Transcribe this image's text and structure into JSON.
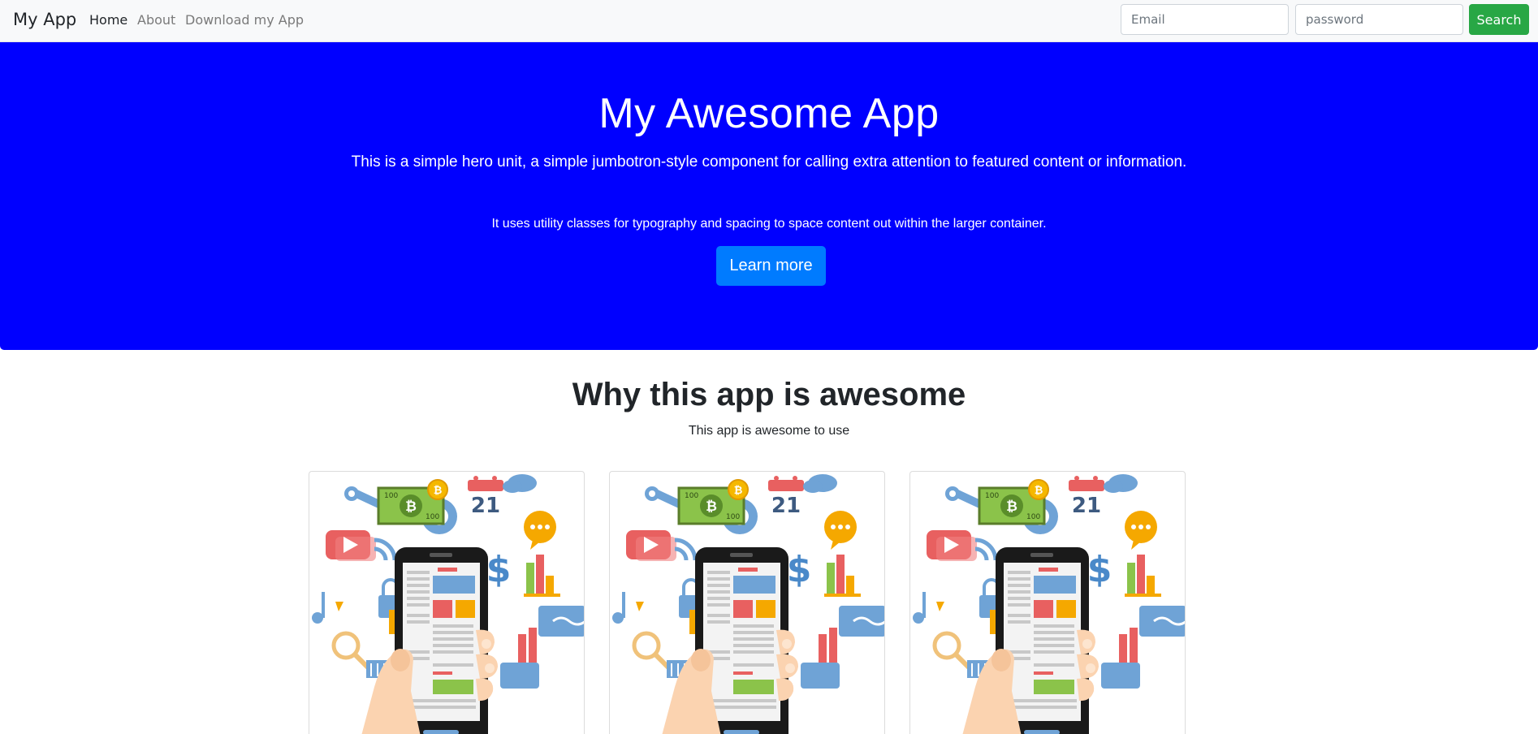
{
  "navbar": {
    "brand": "My App",
    "links": [
      "Home",
      "About",
      "Download my App"
    ],
    "email_placeholder": "Email",
    "password_placeholder": "password",
    "search_label": "Search"
  },
  "hero": {
    "title": "My Awesome App",
    "lead": "This is a simple hero unit, a simple jumbotron-style component for calling extra attention to featured content or information.",
    "text": "It uses utility classes for typography and spacing to space content out within the larger container.",
    "button_label": "Learn more",
    "background": "#0000ff",
    "button_color": "#007bff"
  },
  "features": {
    "title": "Why this app is awesome",
    "subtitle": "This app is awesome to use",
    "cards": [
      {
        "image": "mobile-app-illustration",
        "calendar_day": "21",
        "bill_value": "100"
      },
      {
        "image": "mobile-app-illustration",
        "calendar_day": "21",
        "bill_value": "100"
      },
      {
        "image": "mobile-app-illustration",
        "calendar_day": "21",
        "bill_value": "100"
      }
    ]
  },
  "colors": {
    "search_button": "#28a745",
    "navbar_bg": "#f8f9fa"
  }
}
